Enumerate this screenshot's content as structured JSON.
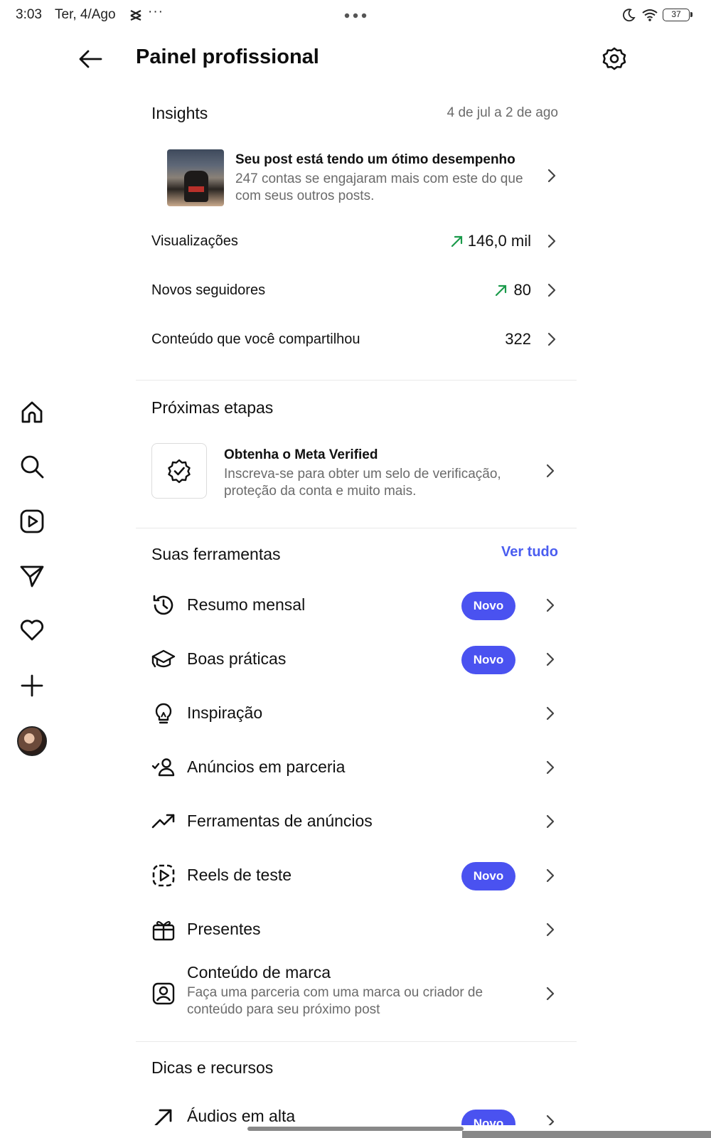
{
  "status_bar": {
    "time": "3:03",
    "date": "Ter, 4/Ago",
    "more": "···",
    "battery": "37"
  },
  "header": {
    "title": "Painel profissional",
    "back_icon": "arrow-left-icon",
    "settings_icon": "gear-icon"
  },
  "rail": {
    "items": [
      "home-icon",
      "search-icon",
      "reels-icon",
      "messages-icon",
      "heart-icon",
      "plus-icon",
      "avatar"
    ]
  },
  "insights": {
    "title": "Insights",
    "date_range": "4 de jul a 2 de ago",
    "post": {
      "title": "Seu post está tendo um ótimo desempenho",
      "description": "247 contas se engajaram mais com este do que com seus outros posts."
    },
    "metrics": [
      {
        "label": "Visualizações",
        "value": "146,0 mil",
        "trend": "up"
      },
      {
        "label": "Novos seguidores",
        "value": "80",
        "trend": "up"
      },
      {
        "label": "Conteúdo que você compartilhou",
        "value": "322",
        "trend": ""
      }
    ]
  },
  "next_steps": {
    "title": "Próximas etapas",
    "item": {
      "title": "Obtenha o Meta Verified",
      "description": "Inscreva-se para obter um selo de verificação, proteção da conta e muito mais."
    }
  },
  "tools": {
    "title": "Suas ferramentas",
    "see_all": "Ver tudo",
    "items": [
      {
        "label": "Resumo mensal",
        "badge": "Novo",
        "icon": "history-icon"
      },
      {
        "label": "Boas práticas",
        "badge": "Novo",
        "icon": "graduation-cap-icon"
      },
      {
        "label": "Inspiração",
        "badge": "",
        "icon": "lightbulb-icon"
      },
      {
        "label": "Anúncios em parceria",
        "badge": "",
        "icon": "partner-user-icon"
      },
      {
        "label": "Ferramentas de anúncios",
        "badge": "",
        "icon": "trending-up-icon"
      },
      {
        "label": "Reels de teste",
        "badge": "Novo",
        "icon": "trial-reels-icon"
      },
      {
        "label": "Presentes",
        "badge": "",
        "icon": "gift-icon"
      },
      {
        "label": "Conteúdo de marca",
        "badge": "",
        "icon": "branded-content-icon",
        "subtitle": "Faça uma parceria com uma marca ou criador de conteúdo para seu próximo post"
      }
    ]
  },
  "tips": {
    "title": "Dicas e recursos",
    "items": [
      {
        "label": "Áudios em alta",
        "badge": "Novo",
        "icon": "arrow-up-right-icon"
      }
    ]
  },
  "colors": {
    "accent": "#4a52f0",
    "link": "#4a5df0",
    "trend_up": "#1a9a4a",
    "secondary_text": "#6b6b6b"
  }
}
